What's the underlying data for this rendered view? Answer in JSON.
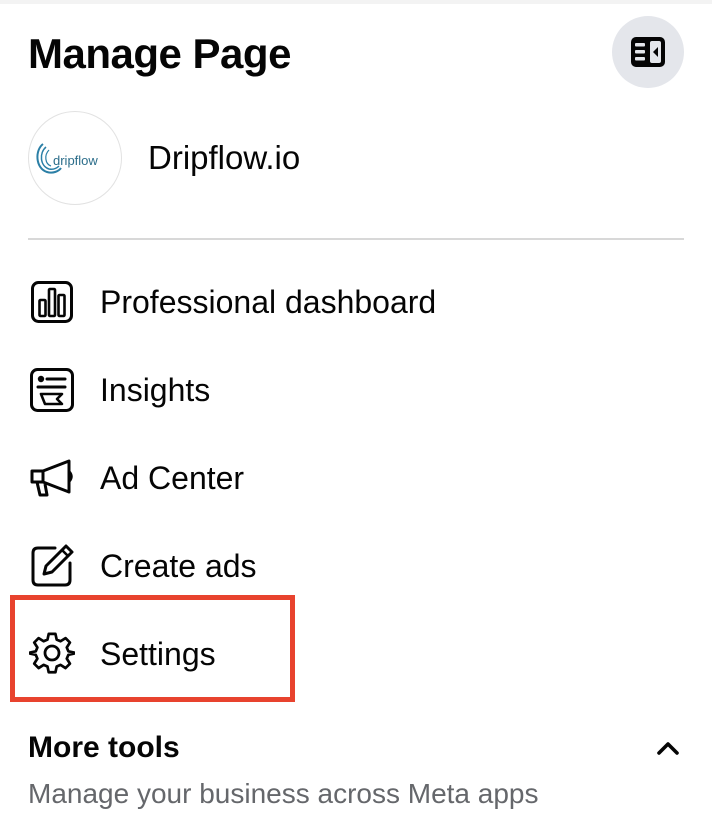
{
  "header": {
    "title": "Manage Page",
    "collapse_icon": "sidebar-collapse-icon"
  },
  "profile": {
    "name": "Dripflow.io",
    "logo_text": "dripflow",
    "logo_color": "#2b7fa6"
  },
  "menu": {
    "items": [
      {
        "label": "Professional dashboard",
        "icon": "bar-chart-icon"
      },
      {
        "label": "Insights",
        "icon": "insights-icon"
      },
      {
        "label": "Ad Center",
        "icon": "megaphone-icon"
      },
      {
        "label": "Create ads",
        "icon": "edit-icon"
      },
      {
        "label": "Settings",
        "icon": "gear-icon"
      }
    ]
  },
  "highlight": {
    "target": "Settings",
    "color": "#e8432e"
  },
  "more_tools": {
    "title": "More tools",
    "subtitle": "Manage your business across Meta apps"
  }
}
